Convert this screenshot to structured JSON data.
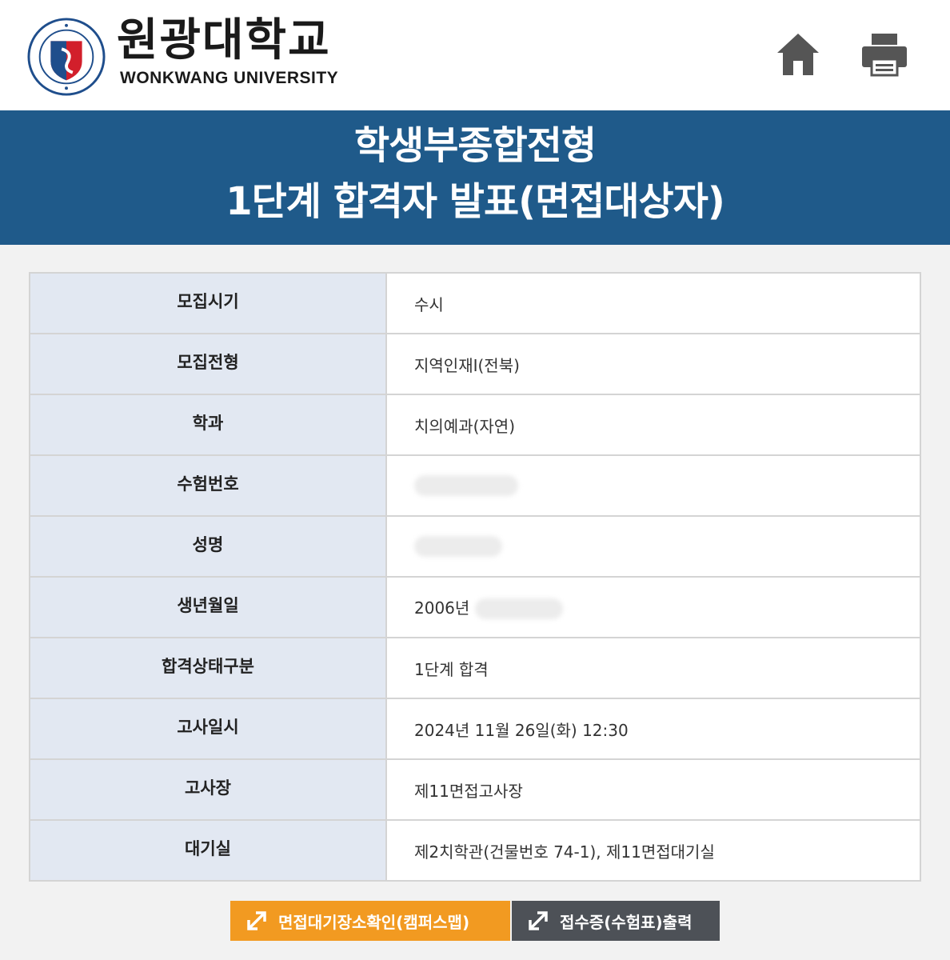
{
  "header": {
    "logo_korean": "원광대학교",
    "logo_english": "WONKWANG UNIVERSITY",
    "home_icon": "home-icon",
    "print_icon": "printer-icon"
  },
  "banner": {
    "title_line1": "학생부종합전형",
    "title_line2": "1단계 합격자 발표(면접대상자)"
  },
  "rows": [
    {
      "label": "모집시기",
      "value": "수시"
    },
    {
      "label": "모집전형",
      "value": "지역인재Ⅰ(전북)"
    },
    {
      "label": "학과",
      "value": "치의예과(자연)"
    },
    {
      "label": "수험번호",
      "value": ""
    },
    {
      "label": "성명",
      "value": ""
    },
    {
      "label": "생년월일",
      "value": "2006년"
    },
    {
      "label": "합격상태구분",
      "value": "1단계 합격"
    },
    {
      "label": "고사일시",
      "value": "2024년 11월 26일(화) 12:30"
    },
    {
      "label": "고사장",
      "value": "제11면접고사장"
    },
    {
      "label": "대기실",
      "value": "제2치학관(건물번호 74-1), 제11면접대기실"
    }
  ],
  "buttons": {
    "map_label": "면접대기장소확인(캠퍼스맵)",
    "print_label": "접수증(수험표)출력"
  },
  "colors": {
    "banner": "#1f5a8a",
    "label_bg": "#e2e8f2",
    "map_button": "#f29a21",
    "print_button": "#4d5157"
  }
}
